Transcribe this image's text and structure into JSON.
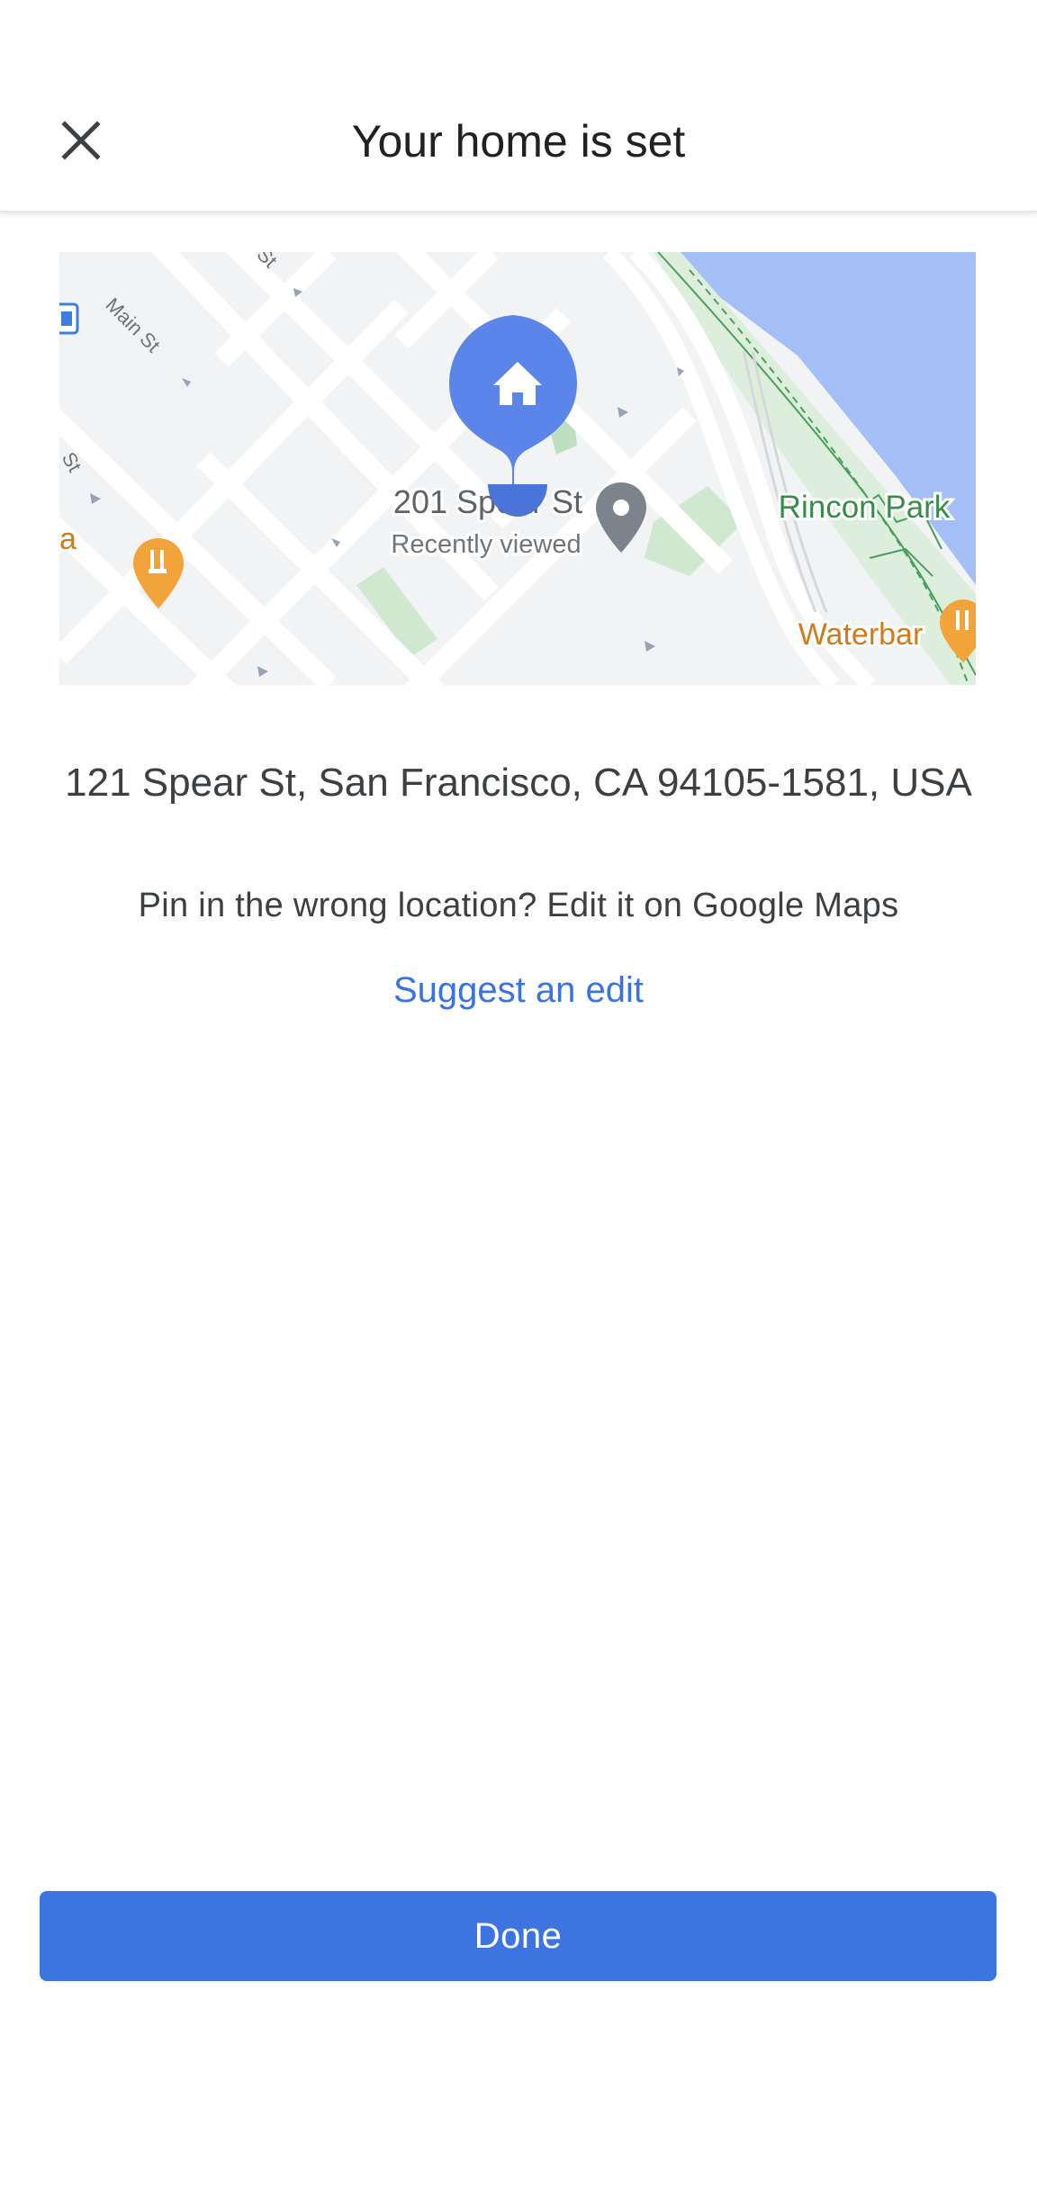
{
  "header": {
    "title": "Your home is set",
    "close_icon": "close-icon"
  },
  "map": {
    "street_labels": [
      "Main St",
      "St",
      "St"
    ],
    "poi_labels": [
      "201 Spear St",
      "Recently viewed",
      "Rincon Park",
      "Waterbar",
      "a"
    ],
    "pins": [
      "home-pin-icon",
      "place-pin-icon",
      "restaurant-icon"
    ],
    "colors": {
      "home_pin": "#5b85e8",
      "water": "#a4bff5",
      "park": "#cbe8cb",
      "restaurant": "#f2a33a",
      "roads": "#ffffff",
      "land": "#f1f3f4"
    }
  },
  "address": "121 Spear St, San Francisco, CA 94105-1581, USA",
  "hint": "Pin in the wrong location? Edit it on Google Maps",
  "suggest_link": "Suggest an edit",
  "done_button": "Done",
  "colors": {
    "accent": "#3d74e0",
    "link": "#3a73e0",
    "text": "#3c4043"
  }
}
